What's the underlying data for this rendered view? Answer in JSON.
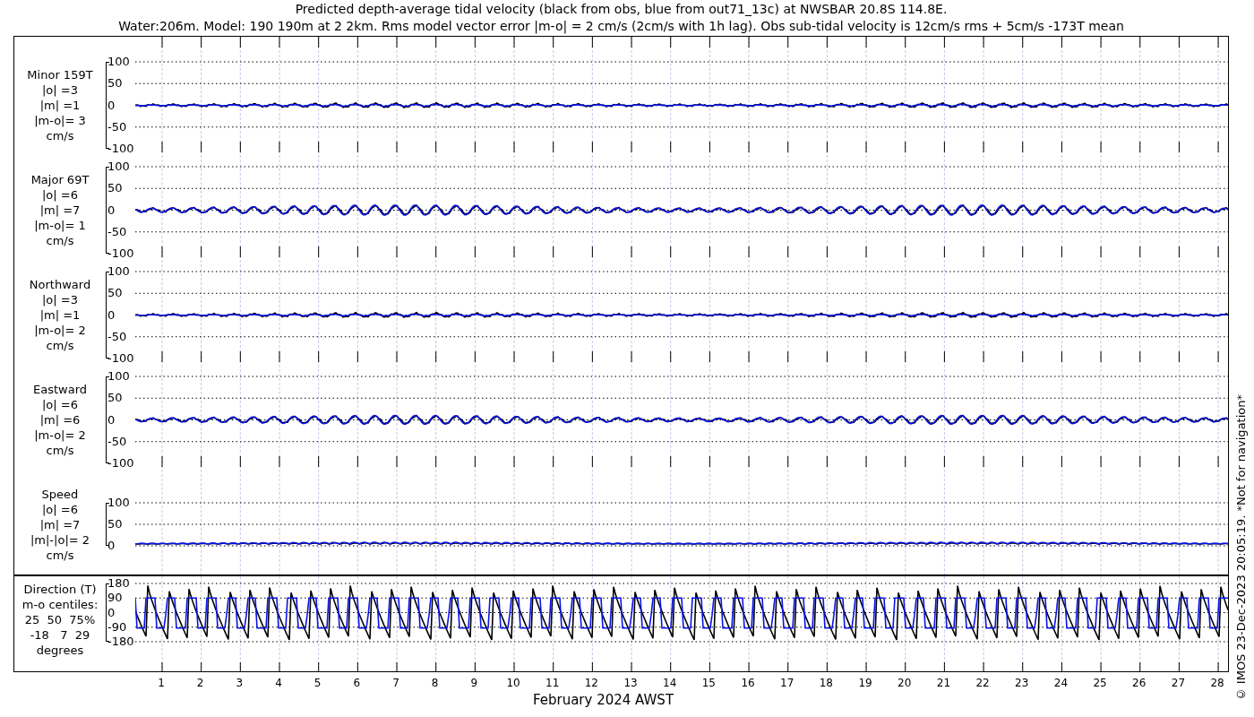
{
  "title": {
    "lines": [
      "Predicted depth-average tidal velocity (black from obs, blue from out71_13c) at NWSBAR 20.8S 114.8E.",
      "Water:206m. Model: 190 190m at 2 2km. Rms model vector error |m-o| = 2 cm/s (2cm/s with 1h lag). Obs sub-tidal velocity is 12cm/s rms + 5cm/s -173T mean"
    ]
  },
  "panels": [
    {
      "kind": "velocity",
      "label": [
        "Minor 159T",
        "|o| =3",
        "|m| =1",
        "|m-o|= 3",
        "cm/s"
      ],
      "yticks": [
        "100",
        "50",
        "0",
        "-50",
        "-100"
      ]
    },
    {
      "kind": "velocity",
      "label": [
        "Major 69T",
        "|o| =6",
        "|m| =7",
        "|m-o|= 1",
        "cm/s"
      ],
      "yticks": [
        "100",
        "50",
        "0",
        "-50",
        "-100"
      ]
    },
    {
      "kind": "velocity",
      "label": [
        "Northward",
        "|o| =3",
        "|m| =1",
        "|m-o|= 2",
        "cm/s"
      ],
      "yticks": [
        "100",
        "50",
        "0",
        "-50",
        "-100"
      ]
    },
    {
      "kind": "velocity",
      "label": [
        "Eastward",
        "|o| =6",
        "|m| =6",
        "|m-o|= 2",
        "cm/s"
      ],
      "yticks": [
        "100",
        "50",
        "0",
        "-50",
        "-100"
      ]
    },
    {
      "kind": "speed",
      "label": [
        "Speed",
        "|o| =6",
        "|m| =7",
        "|m|-|o|= 2",
        "cm/s"
      ],
      "yticks": [
        "100",
        "50",
        "0"
      ]
    },
    {
      "kind": "direction",
      "label": [
        "Direction (T)",
        "m-o centiles:",
        "25  50  75%",
        "-18   7  29",
        "degrees"
      ],
      "yticks": [
        "180",
        "90",
        "0",
        "-90",
        "-180"
      ]
    }
  ],
  "xticks": [
    "1",
    "2",
    "3",
    "4",
    "5",
    "6",
    "7",
    "8",
    "9",
    "10",
    "11",
    "12",
    "13",
    "14",
    "15",
    "16",
    "17",
    "18",
    "19",
    "20",
    "21",
    "22",
    "23",
    "24",
    "25",
    "26",
    "27",
    "28"
  ],
  "xlabel": "February 2024 AWST",
  "footer": "© IMOS 23-Dec-2023 20:05:19. *Not for navigation*"
}
